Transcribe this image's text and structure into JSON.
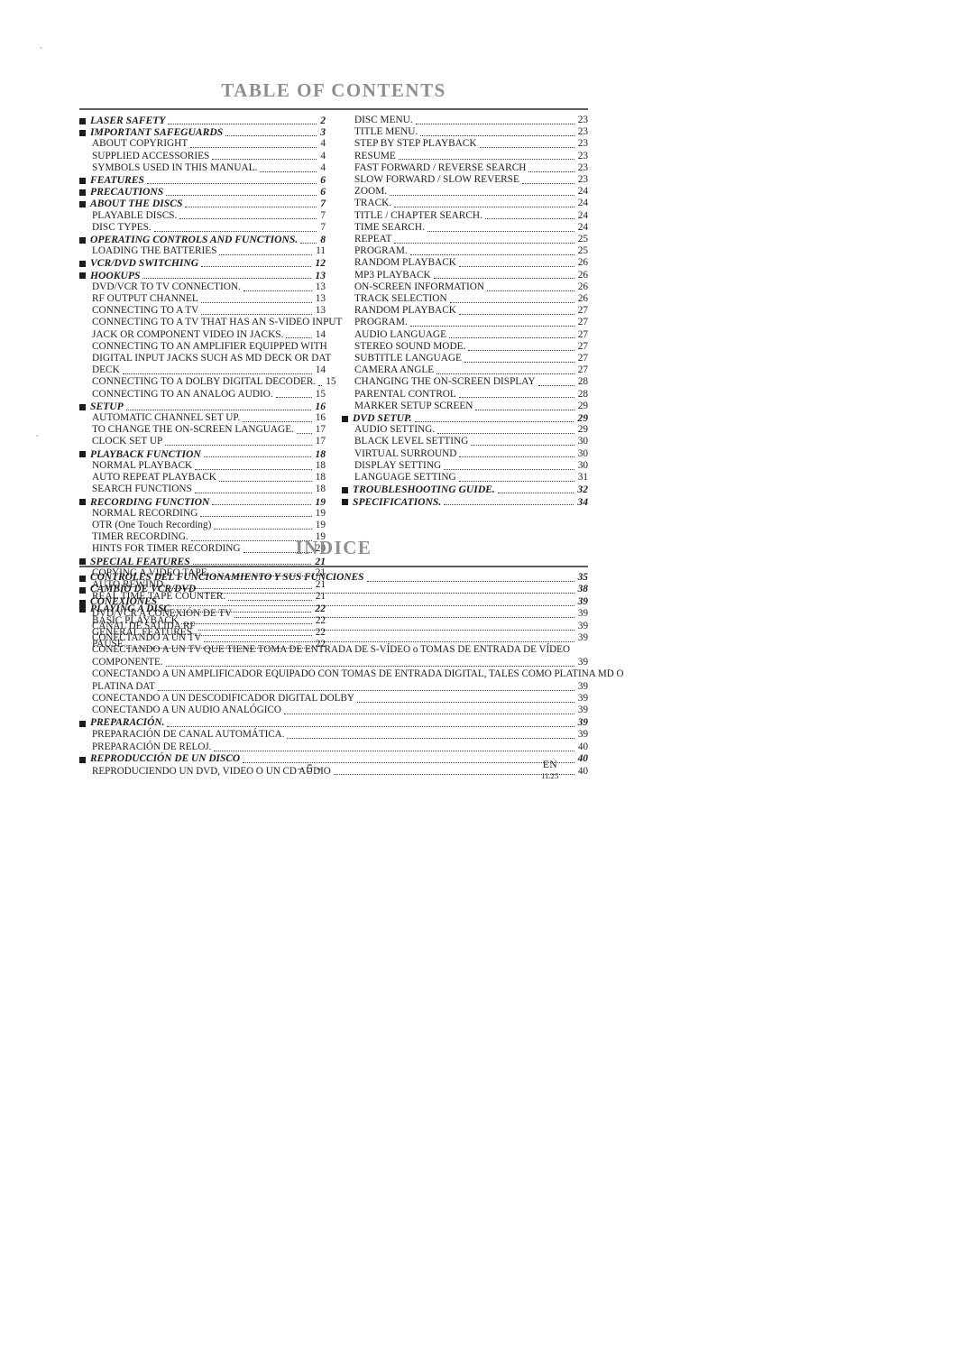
{
  "document": {
    "page_number": "– 5 –",
    "footer_lang": "EN",
    "footer_code": "1L25"
  },
  "toc": {
    "title": "TABLE OF CONTENTS",
    "left_column": [
      {
        "type": "chapter",
        "label": "LASER SAFETY",
        "page": "2"
      },
      {
        "type": "chapter",
        "label": "IMPORTANT SAFEGUARDS",
        "page": "3"
      },
      {
        "type": "sub",
        "label": "ABOUT COPYRIGHT",
        "page": "4"
      },
      {
        "type": "sub",
        "label": "SUPPLIED ACCESSORIES",
        "page": "4"
      },
      {
        "type": "sub",
        "label": "SYMBOLS USED IN THIS MANUAL.",
        "page": "4"
      },
      {
        "type": "chapter",
        "label": "FEATURES",
        "page": "6"
      },
      {
        "type": "chapter",
        "label": "PRECAUTIONS",
        "page": "6"
      },
      {
        "type": "chapter",
        "label": "ABOUT THE DISCS",
        "page": "7"
      },
      {
        "type": "sub",
        "label": "PLAYABLE DISCS.",
        "page": "7"
      },
      {
        "type": "sub",
        "label": "DISC TYPES.",
        "page": "7"
      },
      {
        "type": "chapter",
        "label": "OPERATING CONTROLS AND FUNCTIONS.",
        "page": "8"
      },
      {
        "type": "sub",
        "label": "LOADING THE BATTERIES",
        "page": "11"
      },
      {
        "type": "chapter",
        "label": "VCR/DVD SWITCHING",
        "page": "12"
      },
      {
        "type": "chapter",
        "label": "HOOKUPS",
        "page": "13"
      },
      {
        "type": "sub",
        "label": "DVD/VCR TO TV CONNECTION.",
        "page": "13"
      },
      {
        "type": "sub",
        "label": "RF OUTPUT CHANNEL",
        "page": "13"
      },
      {
        "type": "sub",
        "label": "CONNECTING TO A TV",
        "page": "13"
      },
      {
        "type": "cont",
        "label": "CONNECTING TO A TV THAT HAS AN S-VIDEO INPUT",
        "page": ""
      },
      {
        "type": "sub",
        "label": "JACK OR COMPONENT VIDEO IN JACKS.",
        "page": "14"
      },
      {
        "type": "cont",
        "label": "CONNECTING TO AN AMPLIFIER EQUIPPED WITH",
        "page": ""
      },
      {
        "type": "cont",
        "label": "DIGITAL INPUT JACKS SUCH AS MD DECK OR DAT",
        "page": ""
      },
      {
        "type": "sub",
        "label": "DECK",
        "page": "14"
      },
      {
        "type": "sub",
        "label": "CONNECTING TO A DOLBY DIGITAL DECODER.",
        "page": "15"
      },
      {
        "type": "sub",
        "label": "CONNECTING TO AN ANALOG AUDIO.",
        "page": "15"
      },
      {
        "type": "chapter",
        "label": "SETUP",
        "page": "16"
      },
      {
        "type": "sub",
        "label": "AUTOMATIC CHANNEL SET UP.",
        "page": "16"
      },
      {
        "type": "sub",
        "label": "TO CHANGE THE ON-SCREEN LANGUAGE.",
        "page": "17"
      },
      {
        "type": "sub",
        "label": "CLOCK SET UP",
        "page": "17"
      },
      {
        "type": "chapter",
        "label": "PLAYBACK FUNCTION",
        "page": "18"
      },
      {
        "type": "sub",
        "label": "NORMAL PLAYBACK",
        "page": "18"
      },
      {
        "type": "sub",
        "label": "AUTO REPEAT PLAYBACK",
        "page": "18"
      },
      {
        "type": "sub",
        "label": "SEARCH FUNCTIONS",
        "page": "18"
      },
      {
        "type": "chapter",
        "label": "RECORDING FUNCTION",
        "page": "19"
      },
      {
        "type": "sub",
        "label": "NORMAL RECORDING",
        "page": "19"
      },
      {
        "type": "sub",
        "label": "OTR (One Touch Recording)",
        "page": "19"
      },
      {
        "type": "sub",
        "label": "TIMER RECORDING.",
        "page": "19"
      },
      {
        "type": "sub",
        "label": "HINTS FOR TIMER RECORDING",
        "page": "20"
      },
      {
        "type": "chapter",
        "label": "SPECIAL FEATURES",
        "page": "21"
      },
      {
        "type": "sub",
        "label": "COPYING A VIDEO TAPE.",
        "page": "21"
      },
      {
        "type": "sub",
        "label": "AUTO REWIND.",
        "page": "21"
      },
      {
        "type": "sub",
        "label": "REAL TIME TAPE COUNTER.",
        "page": "21"
      },
      {
        "type": "chapter",
        "label": "PLAYING A DISC",
        "page": "22"
      },
      {
        "type": "sub",
        "label": "BASIC PLAYBACK",
        "page": "22"
      },
      {
        "type": "sub",
        "label": "GENERAL FEATURES",
        "page": "22"
      },
      {
        "type": "sub",
        "label": "PAUSE",
        "page": "22"
      }
    ],
    "right_column": [
      {
        "type": "sub",
        "label": "DISC MENU.",
        "page": "23"
      },
      {
        "type": "sub",
        "label": "TITLE MENU.",
        "page": "23"
      },
      {
        "type": "sub",
        "label": "STEP BY STEP PLAYBACK",
        "page": "23"
      },
      {
        "type": "sub",
        "label": "RESUME",
        "page": "23"
      },
      {
        "type": "sub",
        "label": "FAST FORWARD / REVERSE SEARCH",
        "page": "23"
      },
      {
        "type": "sub",
        "label": "SLOW FORWARD / SLOW REVERSE",
        "page": "23"
      },
      {
        "type": "sub",
        "label": "ZOOM.",
        "page": "24"
      },
      {
        "type": "sub",
        "label": "TRACK.",
        "page": "24"
      },
      {
        "type": "sub",
        "label": "TITLE / CHAPTER SEARCH.",
        "page": "24"
      },
      {
        "type": "sub",
        "label": "TIME SEARCH.",
        "page": "24"
      },
      {
        "type": "sub",
        "label": "REPEAT",
        "page": "25"
      },
      {
        "type": "sub",
        "label": "PROGRAM.",
        "page": "25"
      },
      {
        "type": "sub",
        "label": "RANDOM PLAYBACK",
        "page": "26"
      },
      {
        "type": "sub",
        "label": "MP3 PLAYBACK",
        "page": "26"
      },
      {
        "type": "sub",
        "label": "ON-SCREEN INFORMATION",
        "page": "26"
      },
      {
        "type": "sub",
        "label": "TRACK SELECTION",
        "page": "26"
      },
      {
        "type": "sub",
        "label": "RANDOM PLAYBACK",
        "page": "27"
      },
      {
        "type": "sub",
        "label": "PROGRAM.",
        "page": "27"
      },
      {
        "type": "sub",
        "label": "AUDIO LANGUAGE",
        "page": "27"
      },
      {
        "type": "sub",
        "label": "STEREO SOUND MODE.",
        "page": "27"
      },
      {
        "type": "sub",
        "label": "SUBTITLE LANGUAGE",
        "page": "27"
      },
      {
        "type": "sub",
        "label": "CAMERA ANGLE",
        "page": "27"
      },
      {
        "type": "sub",
        "label": "CHANGING THE ON-SCREEN DISPLAY",
        "page": "28"
      },
      {
        "type": "sub",
        "label": "PARENTAL CONTROL",
        "page": "28"
      },
      {
        "type": "sub",
        "label": "MARKER SETUP SCREEN",
        "page": "29"
      },
      {
        "type": "chapter",
        "label": "DVD SETUP.",
        "page": "29"
      },
      {
        "type": "sub",
        "label": "AUDIO SETTING.",
        "page": "29"
      },
      {
        "type": "sub",
        "label": "BLACK LEVEL SETTING",
        "page": "30"
      },
      {
        "type": "sub",
        "label": "VIRTUAL SURROUND",
        "page": "30"
      },
      {
        "type": "sub",
        "label": "DISPLAY SETTING",
        "page": "30"
      },
      {
        "type": "sub",
        "label": "LANGUAGE SETTING",
        "page": "31"
      },
      {
        "type": "chapter",
        "label": "TROUBLESHOOTING GUIDE.",
        "page": "32"
      },
      {
        "type": "chapter",
        "label": "SPECIFICATIONS.",
        "page": "34"
      }
    ]
  },
  "indice": {
    "title": "INDICE",
    "entries": [
      {
        "type": "chapter",
        "label": "CONTROLES DEL FUNCIONAMIENTO Y SUS FUNCIONES",
        "page": "35"
      },
      {
        "type": "chapter",
        "label": "CAMBIO DE VCR/DVD",
        "page": "38"
      },
      {
        "type": "chapter",
        "label": "CONEXIONES",
        "page": "39"
      },
      {
        "type": "sub",
        "label": "DVD/VCR A CONEXIÓN DE TV",
        "page": "39"
      },
      {
        "type": "sub",
        "label": "CANAL DE SALIDA RF",
        "page": "39"
      },
      {
        "type": "sub",
        "label": "CONECTANDO A UN TV",
        "page": "39"
      },
      {
        "type": "cont",
        "label": "CONECTANDO A UN TV QUE TIENE TOMA DE ENTRADA DE S-VÍDEO o TOMAS DE ENTRADA DE VÍDEO",
        "page": ""
      },
      {
        "type": "sub",
        "label": "COMPONENTE.",
        "page": "39"
      },
      {
        "type": "cont",
        "label": "CONECTANDO A UN AMPLIFICADOR EQUIPADO CON TOMAS DE ENTRADA DIGITAL, TALES COMO PLATINA MD O",
        "page": ""
      },
      {
        "type": "sub",
        "label": "PLATINA DAT",
        "page": "39"
      },
      {
        "type": "sub",
        "label": "CONECTANDO A UN DESCODIFICADOR DIGITAL DOLBY",
        "page": "39"
      },
      {
        "type": "sub",
        "label": "CONECTANDO A UN AUDIO ANALÓGICO",
        "page": "39"
      },
      {
        "type": "chapter",
        "label": "PREPARACIÓN.",
        "page": "39"
      },
      {
        "type": "sub",
        "label": "PREPARACIÓN DE CANAL AUTOMÁTICA.",
        "page": "39"
      },
      {
        "type": "sub",
        "label": "PREPARACIÓN DE RELOJ.",
        "page": "40"
      },
      {
        "type": "chapter",
        "label": "REPRODUCCIÓN DE UN DISCO",
        "page": "40"
      },
      {
        "type": "sub",
        "label": "REPRODUCIENDO UN DVD, VIDEO O UN CD AUDIO",
        "page": "40"
      }
    ]
  }
}
